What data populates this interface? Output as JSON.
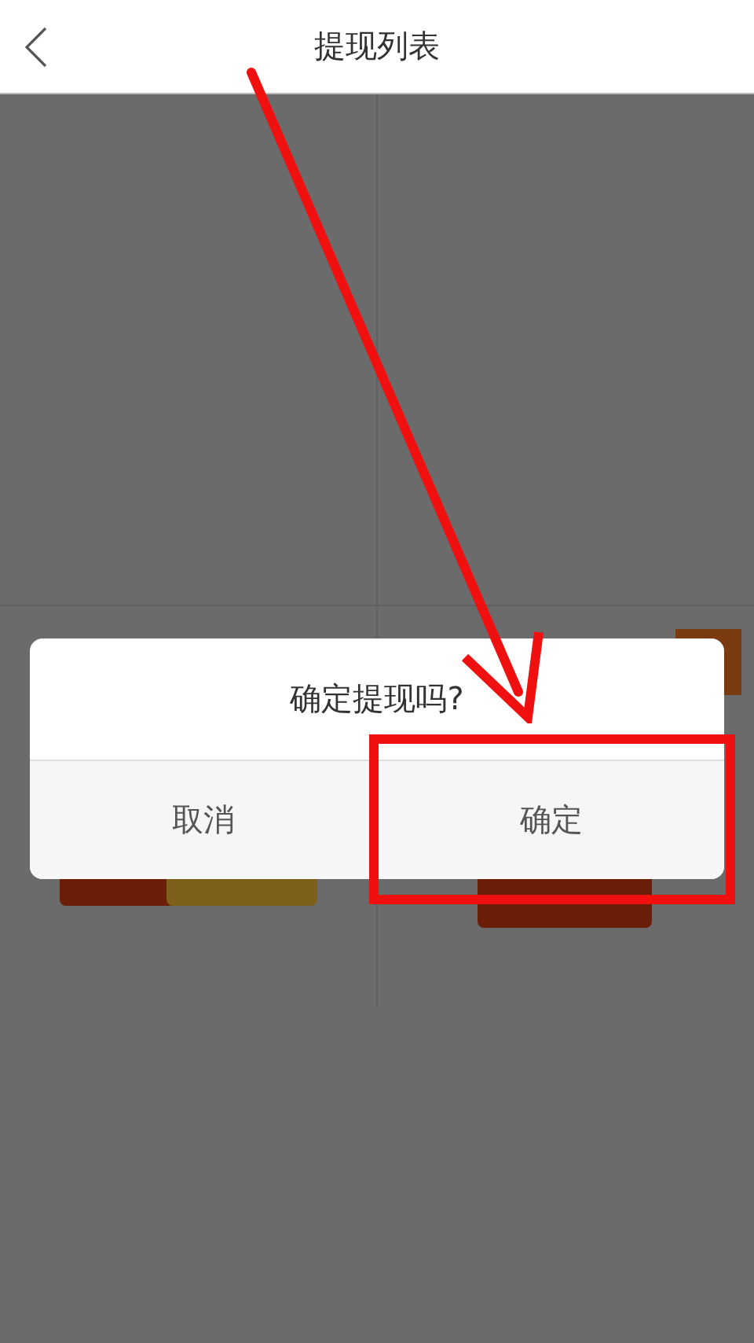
{
  "header": {
    "title": "提现列表"
  },
  "dialog": {
    "message": "确定提现吗?",
    "buttons": [
      {
        "label": "取消"
      },
      {
        "label": "确定"
      }
    ]
  }
}
